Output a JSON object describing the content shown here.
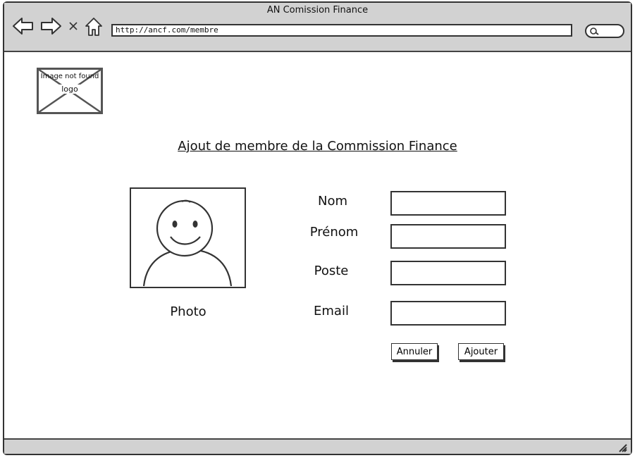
{
  "window": {
    "title": "AN Comission Finance",
    "url": "http://ancf.com/membre"
  },
  "logo": {
    "alt_text": "Image not found",
    "label": "logo"
  },
  "page": {
    "title": "Ajout de membre de la Commission Finance"
  },
  "photo": {
    "caption": "Photo"
  },
  "form": {
    "fields": [
      {
        "label": "Nom",
        "value": ""
      },
      {
        "label": "Prénom",
        "value": ""
      },
      {
        "label": "Poste",
        "value": ""
      },
      {
        "label": "Email",
        "value": ""
      }
    ],
    "cancel_label": "Annuler",
    "submit_label": "Ajouter"
  },
  "icons": {
    "back": "back-arrow-icon",
    "forward": "forward-arrow-icon",
    "stop": "close-icon",
    "home": "home-icon",
    "search": "search-icon",
    "resize": "resize-grip-icon"
  },
  "colors": {
    "chrome": "#d2d2d2",
    "stroke": "#333333",
    "background": "#ffffff"
  }
}
